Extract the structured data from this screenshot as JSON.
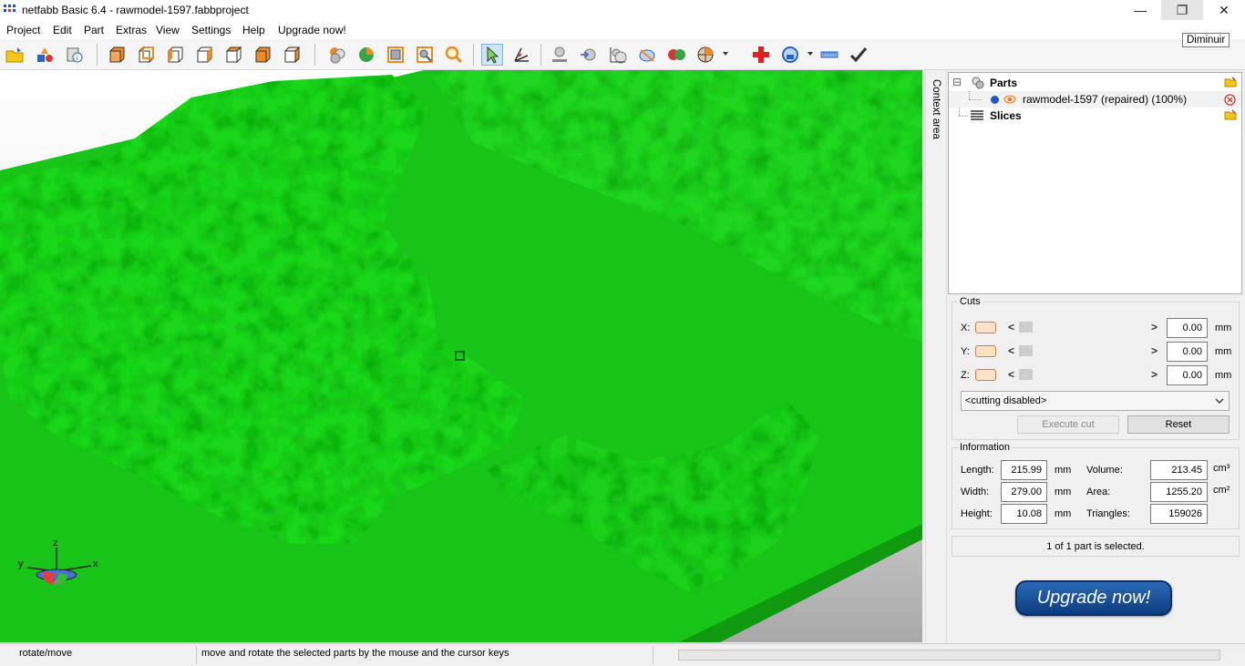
{
  "window": {
    "title": "netfabb Basic 6.4 - rawmodel-1597.fabbproject",
    "minimize_glyph": "—",
    "restore_glyph": "❐",
    "close_glyph": "✕",
    "tooltip": "Diminuir"
  },
  "menu": {
    "items": [
      "Project",
      "Edit",
      "Part",
      "Extras",
      "View",
      "Settings",
      "Help",
      "Upgrade now!"
    ]
  },
  "toolbar": {
    "icons": [
      "open-project-icon",
      "add-part-icon",
      "part-info-icon",
      "view-front-icon",
      "view-back-icon",
      "view-left-icon",
      "view-right-icon",
      "view-top-icon",
      "view-bottom-icon",
      "view-iso-icon",
      "colors-icon",
      "shaded-view-icon",
      "zoom-fit-icon",
      "zoom-selection-icon",
      "zoom-icon",
      "select-pointer-icon",
      "rotate-move-icon",
      "drop-to-platform-icon",
      "move-part-icon",
      "scale-part-icon",
      "mirror-part-icon",
      "cut-part-icon",
      "section-view-icon",
      "repair-icon",
      "analysis-icon",
      "measure-icon",
      "apply-repair-icon"
    ]
  },
  "viewport": {
    "model_color": "#1fd61f",
    "axes": {
      "z": "z",
      "y": "y",
      "x": "x"
    }
  },
  "context_area": {
    "label": "Context area"
  },
  "tree": {
    "parts_label": "Parts",
    "part_item_label": "rawmodel-1597 (repaired) (100%)",
    "slices_label": "Slices",
    "expand_glyph": "⊟"
  },
  "cuts": {
    "title": "Cuts",
    "axes": [
      {
        "label": "X:",
        "value": "0.00",
        "unit": "mm"
      },
      {
        "label": "Y:",
        "value": "0.00",
        "unit": "mm"
      },
      {
        "label": "Z:",
        "value": "0.00",
        "unit": "mm"
      }
    ],
    "arrow_left": "<",
    "arrow_right": ">",
    "mode_select": "<cutting disabled>",
    "execute_label": "Execute cut",
    "reset_label": "Reset"
  },
  "information": {
    "title": "Information",
    "length_label": "Length:",
    "length_value": "215.99",
    "length_unit": "mm",
    "width_label": "Width:",
    "width_value": "279.00",
    "width_unit": "mm",
    "height_label": "Height:",
    "height_value": "10.08",
    "height_unit": "mm",
    "volume_label": "Volume:",
    "volume_value": "213.45",
    "volume_unit": "cm³",
    "area_label": "Area:",
    "area_value": "1255.20",
    "area_unit": "cm²",
    "triangles_label": "Triangles:",
    "triangles_value": "159026"
  },
  "selection_status": "1 of 1 part is selected.",
  "upgrade_button": "Upgrade now!",
  "statusbar": {
    "mode": "rotate/move",
    "hint": "move and rotate the selected parts by the mouse and the cursor keys"
  }
}
